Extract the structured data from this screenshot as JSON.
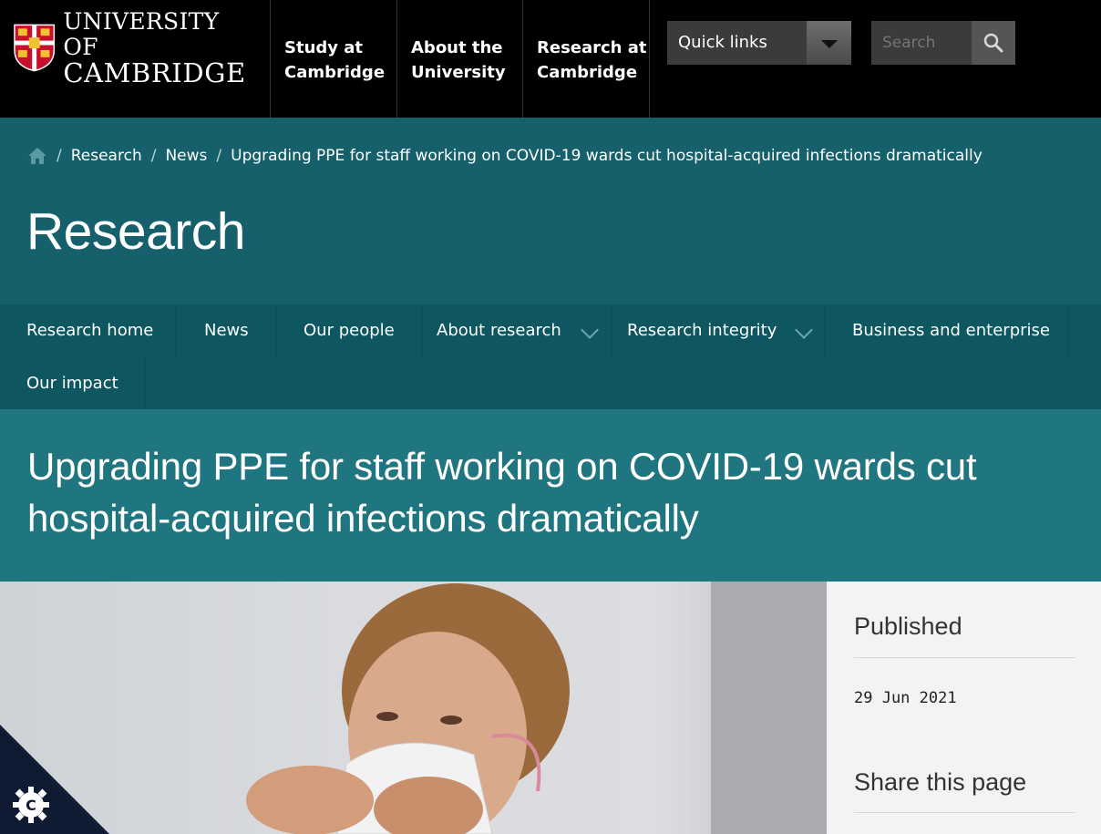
{
  "header": {
    "logo": {
      "line1": "UNIVERSITY OF",
      "line2": "CAMBRIDGE",
      "icon": "university-crest-icon"
    },
    "nav": [
      {
        "line1": "Study at",
        "line2": "Cambridge"
      },
      {
        "line1": "About the",
        "line2": "University"
      },
      {
        "line1": "Research at",
        "line2": "Cambridge"
      }
    ],
    "quick_links_label": "Quick links",
    "search_placeholder": "Search"
  },
  "banner": {
    "breadcrumb": [
      "Research",
      "News",
      "Upgrading PPE for staff working on COVID-19 wards cut hospital-acquired infections dramatically"
    ],
    "section_title": "Research"
  },
  "section_nav": {
    "items": [
      "Research home",
      "News",
      "Our people",
      "About research",
      "Research integrity",
      "Business and enterprise",
      "Our impact"
    ]
  },
  "article": {
    "title": "Upgrading PPE for staff working on COVID-19 wards cut hospital-acquired infections dramatically",
    "published_label": "Published",
    "published_date": "29 Jun 2021",
    "share_label": "Share this page"
  },
  "colors": {
    "header_bg": "#000000",
    "banner_teal": "#15606b",
    "section_nav_teal": "#0e5660",
    "article_head_teal": "#1f7680",
    "sidebar_bg": "#f3f3f3"
  }
}
